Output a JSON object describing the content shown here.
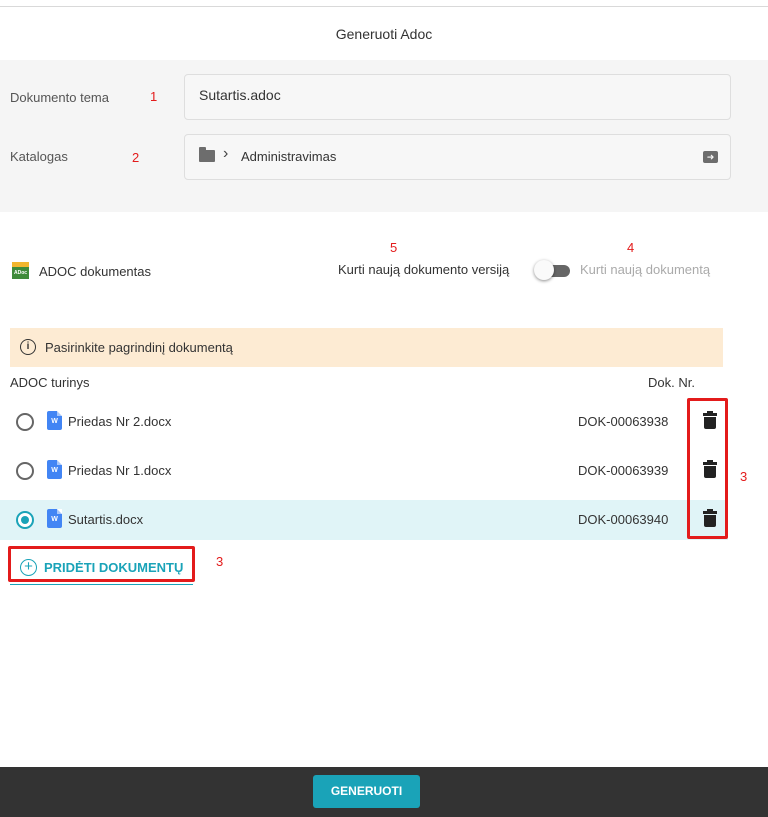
{
  "dialog": {
    "title": "Generuoti Adoc"
  },
  "form": {
    "topic_label": "Dokumento tema",
    "topic_value": "Sutartis.adoc",
    "catalog_label": "Katalogas",
    "catalog_path": "Administravimas"
  },
  "adoc": {
    "title": "ADOC dokumentas",
    "icon_text": "ADoc",
    "toggle_left_label": "Kurti naują dokumento versiją",
    "toggle_right_label": "Kurti naują dokumentą",
    "toggle_on": false
  },
  "banner": {
    "text": "Pasirinkite pagrindinį dokumentą"
  },
  "table": {
    "col_content": "ADOC turinys",
    "col_number": "Dok. Nr.",
    "rows": [
      {
        "name": "Priedas Nr 2.docx",
        "number": "DOK-00063938",
        "selected": false
      },
      {
        "name": "Priedas Nr 1.docx",
        "number": "DOK-00063939",
        "selected": false
      },
      {
        "name": "Sutartis.docx",
        "number": "DOK-00063940",
        "selected": true
      }
    ]
  },
  "actions": {
    "add_label": "PRIDĖTI DOKUMENTŲ",
    "generate_label": "GENERUOTI"
  },
  "annotations": {
    "n1": "1",
    "n2": "2",
    "n3a": "3",
    "n3b": "3",
    "n4": "4",
    "n5": "5"
  },
  "colors": {
    "accent": "#1aa3b8",
    "annotation": "#e31b1b",
    "banner_bg": "#fdebd3",
    "footer_bg": "#333333"
  },
  "icons": [
    "folder-icon",
    "chevron-right-icon",
    "move-to-folder-icon",
    "adoc-file-icon",
    "info-icon",
    "word-file-icon",
    "trash-icon",
    "plus-circle-icon"
  ]
}
